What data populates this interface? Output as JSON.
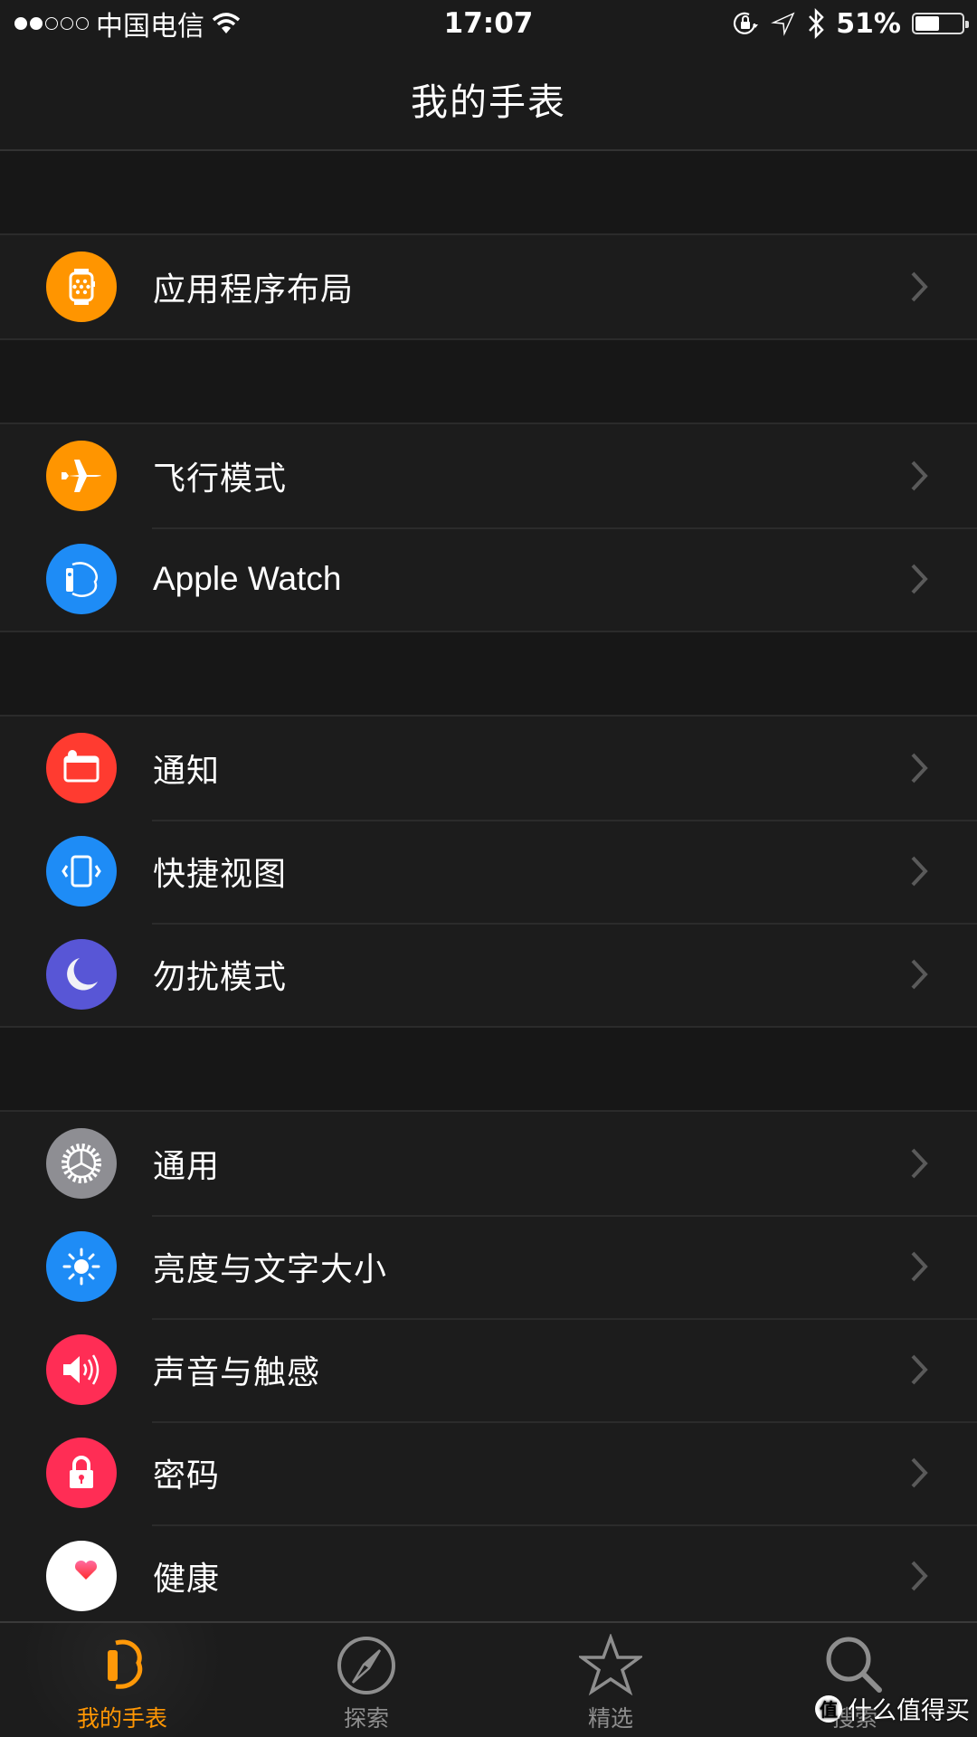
{
  "status_bar": {
    "signal_bars_filled": 2,
    "signal_bars_total": 5,
    "carrier": "中国电信",
    "time": "17:07",
    "battery_percent_text": "51%",
    "battery_level": 0.51
  },
  "nav": {
    "title": "我的手表"
  },
  "groups": [
    {
      "items": [
        {
          "label": "应用程序布局",
          "icon": "app-layout-watch-icon",
          "color": "#ff9500"
        }
      ]
    },
    {
      "items": [
        {
          "label": "飞行模式",
          "icon": "airplane-icon",
          "color": "#ff9500"
        },
        {
          "label": "Apple Watch",
          "icon": "apple-watch-side-icon",
          "color": "#1e8cf6"
        }
      ]
    },
    {
      "items": [
        {
          "label": "通知",
          "icon": "notification-icon",
          "color": "#ff3b30"
        },
        {
          "label": "快捷视图",
          "icon": "glances-icon",
          "color": "#1e8cf6"
        },
        {
          "label": "勿扰模式",
          "icon": "moon-icon",
          "color": "#5856d6"
        }
      ]
    },
    {
      "items": [
        {
          "label": "通用",
          "icon": "gear-icon",
          "color": "#8e8e93"
        },
        {
          "label": "亮度与文字大小",
          "icon": "brightness-icon",
          "color": "#1e8cf6"
        },
        {
          "label": "声音与触感",
          "icon": "speaker-icon",
          "color": "#ff2d55"
        },
        {
          "label": "密码",
          "icon": "lock-icon",
          "color": "#ff2d55"
        },
        {
          "label": "健康",
          "icon": "heart-icon",
          "color": "#ffffff"
        }
      ]
    }
  ],
  "tabs": [
    {
      "label": "我的手表",
      "icon": "watch-tab-icon",
      "active": true
    },
    {
      "label": "探索",
      "icon": "compass-icon",
      "active": false
    },
    {
      "label": "精选",
      "icon": "star-icon",
      "active": false
    },
    {
      "label": "搜索",
      "icon": "search-icon",
      "active": false
    }
  ],
  "colors": {
    "accent": "#ff9500",
    "tab_inactive": "#8e8e8e",
    "chevron": "#5a5a5a"
  },
  "watermark": {
    "badge": "值",
    "text": "什么值得买"
  }
}
